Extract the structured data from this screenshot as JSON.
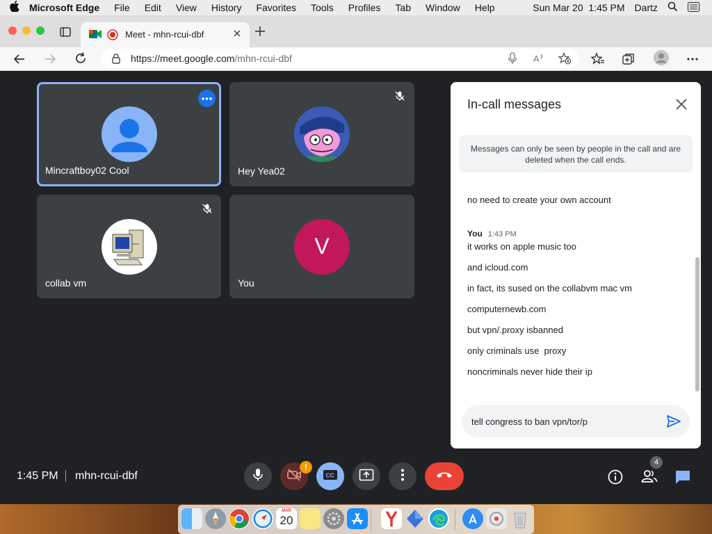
{
  "menubar": {
    "app_name": "Microsoft Edge",
    "items": [
      "File",
      "Edit",
      "View",
      "History",
      "Favorites",
      "Tools",
      "Profiles",
      "Tab",
      "Window",
      "Help"
    ],
    "clock": "Sun Mar 20  1:45 PM",
    "user": "Dartz"
  },
  "browser": {
    "tab_title": "Meet - mhn-rcui-dbf",
    "url_host": "https://meet.google.com",
    "url_path": "/mhn-rcui-dbf"
  },
  "tiles": [
    {
      "name": "Mincraftboy02 Cool",
      "avatar": "person-silhouette",
      "highlighted": true,
      "muted": false
    },
    {
      "name": "Hey Yea02",
      "avatar": "cartoon-character",
      "muted": true
    },
    {
      "name": "collab vm",
      "avatar": "computer-clipart",
      "muted": true
    },
    {
      "name": "You",
      "avatar": "letter",
      "letter": "V"
    }
  ],
  "chat": {
    "title": "In-call messages",
    "notice": "Messages can only be seen by people in the call and are deleted when the call ends.",
    "earlier_message": "no need to create your own account",
    "sender": "You",
    "time": "1:43 PM",
    "messages": [
      "it works on apple music too",
      "and icloud.com",
      "in fact, its sused on the collabvm mac vm",
      "computernewb.com",
      "but vpn/.proxy isbanned",
      "only criminals use  proxy",
      "noncriminals never hide their ip"
    ],
    "input_value": "tell congress to ban vpn/tor/p"
  },
  "bottombar": {
    "time": "1:45 PM",
    "meeting_code": "mhn-rcui-dbf",
    "people_count": "4",
    "camera_warning": "!"
  },
  "dock": {
    "calendar_month": "MAR",
    "calendar_day": "20"
  },
  "colors": {
    "meet_bg": "#202124",
    "tile_bg": "#3c4043",
    "highlight": "#8ab4f8",
    "hangup": "#ea4335",
    "captions": "#8ab4f8",
    "send": "#1a73e8",
    "you_avatar": "#c2185b"
  }
}
